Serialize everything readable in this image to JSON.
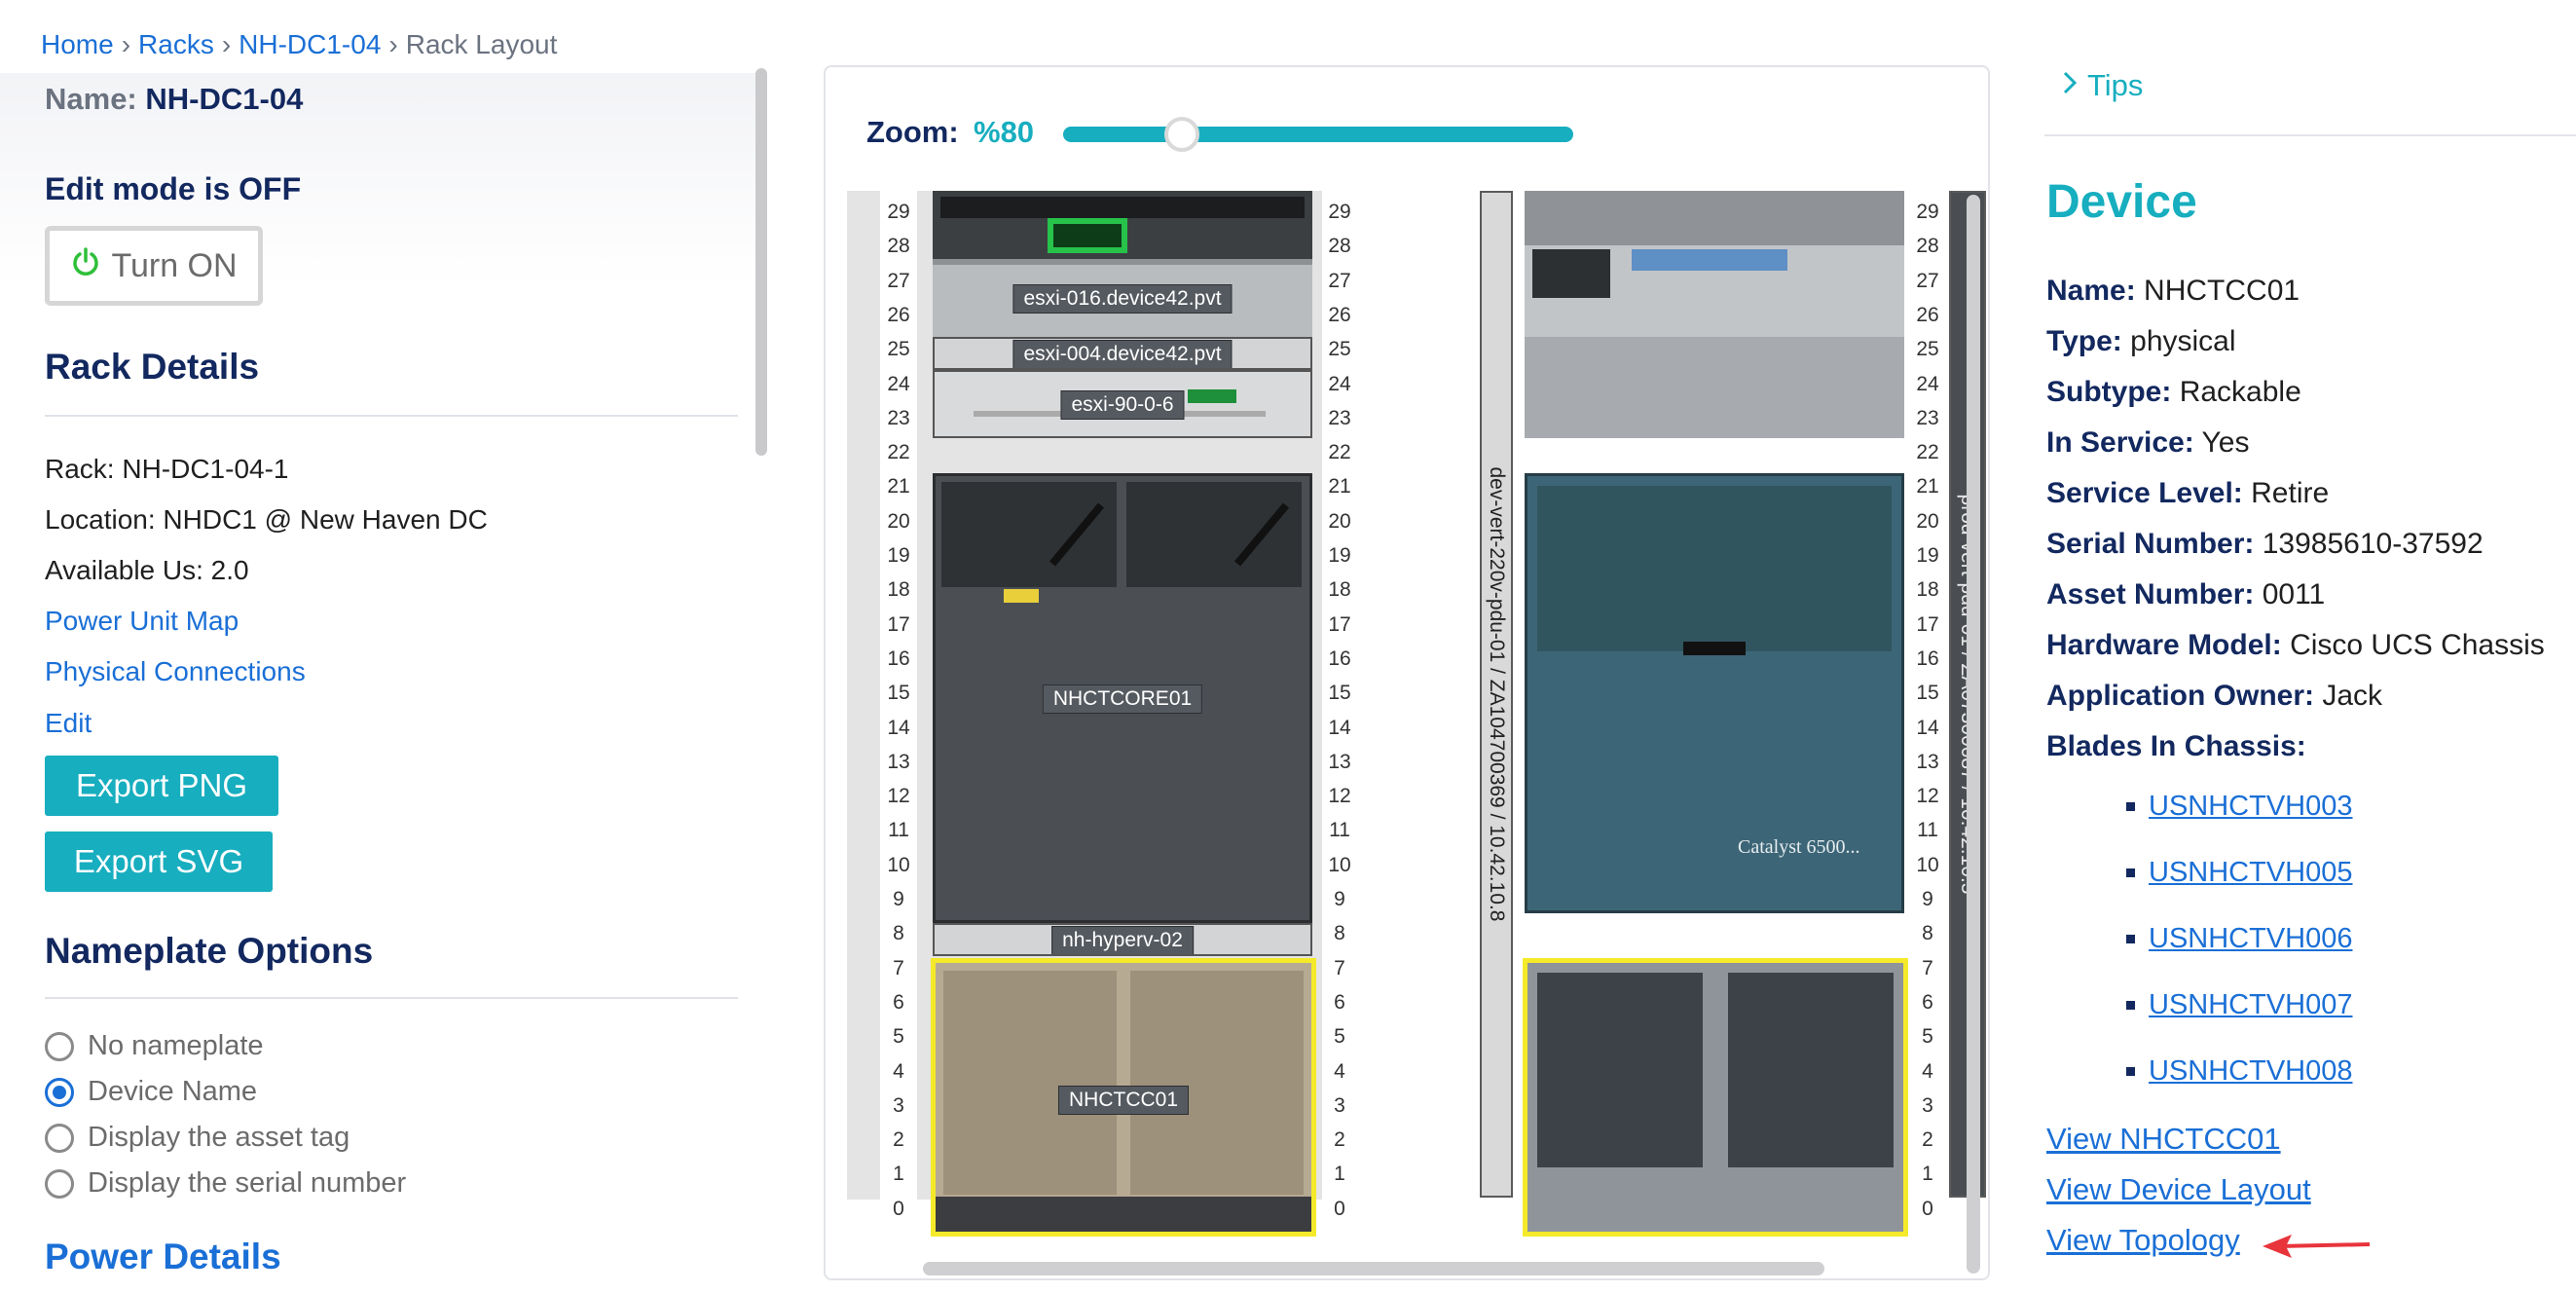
{
  "breadcrumb": {
    "home": "Home",
    "racks": "Racks",
    "rack": "NH-DC1-04",
    "current": "Rack Layout"
  },
  "rack_header": {
    "name_label": "Name:",
    "name_value": "NH-DC1-04"
  },
  "edit_mode": {
    "status": "Edit mode is OFF",
    "button_label": "Turn ON"
  },
  "rack_details": {
    "heading": "Rack Details",
    "rack": "Rack: NH-DC1-04-1",
    "location": "Location: NHDC1 @ New Haven DC",
    "available": "Available Us: 2.0",
    "links": [
      "Power Unit Map",
      "Physical Connections",
      "Edit"
    ],
    "export_png": "Export PNG",
    "export_svg": "Export SVG"
  },
  "nameplate_options": {
    "heading": "Nameplate Options",
    "options": [
      "No nameplate",
      "Device Name",
      "Display the asset tag",
      "Display the serial number"
    ],
    "selected": "Device Name"
  },
  "power_details": {
    "heading": "Power Details"
  },
  "zoom": {
    "label": "Zoom:",
    "value": "%80",
    "level": 0.8
  },
  "rack_units": [
    "29",
    "28",
    "27",
    "26",
    "25",
    "24",
    "23",
    "22",
    "21",
    "20",
    "19",
    "18",
    "17",
    "16",
    "15",
    "14",
    "13",
    "12",
    "11",
    "10",
    "9",
    "8",
    "7",
    "6",
    "5",
    "4",
    "3",
    "2",
    "1",
    "0"
  ],
  "front_devices": {
    "esxi016": "esxi-016.device42.pvt",
    "esxi004": "esxi-004.device42.pvt",
    "esxi90": "esxi-90-0-6",
    "core": "NHCTCORE01",
    "hyperv": "nh-hyperv-02",
    "chassis": "NHCTCC01"
  },
  "pdus": {
    "left": "dev-vert-220v-pdu-01 / ZA104700369 / 10.42.10.8",
    "right": "prod-vert-pdu-01 / ZA07300687 / 10.42.10.5"
  },
  "back_devices": {
    "catalyst_label": "Catalyst 6500..."
  },
  "tips": {
    "label": "Tips"
  },
  "device": {
    "title": "Device",
    "properties": [
      {
        "key": "Name:",
        "value": "NHCTCC01"
      },
      {
        "key": "Type:",
        "value": "physical"
      },
      {
        "key": "Subtype:",
        "value": "Rackable"
      },
      {
        "key": "In Service:",
        "value": "Yes"
      },
      {
        "key": "Service Level:",
        "value": "Retire"
      },
      {
        "key": "Serial Number:",
        "value": "13985610-37592"
      },
      {
        "key": "Asset Number:",
        "value": "0011"
      },
      {
        "key": "Hardware Model:",
        "value": "Cisco UCS Chassis"
      },
      {
        "key": "Application Owner:",
        "value": "Jack"
      },
      {
        "key": "Blades In Chassis:",
        "value": ""
      }
    ],
    "blades": [
      "USNHCTVH003",
      "USNHCTVH005",
      "USNHCTVH006",
      "USNHCTVH007",
      "USNHCTVH008"
    ],
    "view_device": "View NHCTCC01",
    "view_layout": "View Device Layout",
    "view_topology": "View Topology"
  },
  "colors": {
    "accent": "#17aebf",
    "navy": "#12285f",
    "link": "#1a6fd6",
    "highlight": "#f5ea2a",
    "arrow": "#e8343b"
  }
}
